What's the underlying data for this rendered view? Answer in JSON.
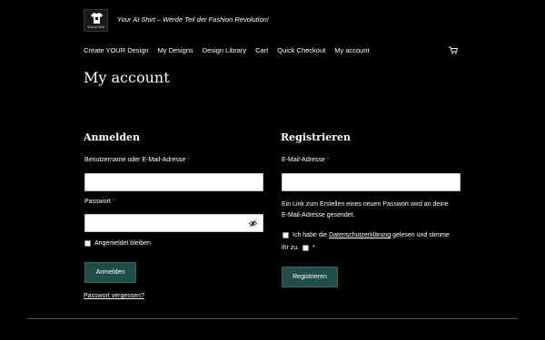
{
  "site": {
    "logo_text": "Your AI Shirt",
    "tagline": "Your AI Shirt – Werde Teil der Fashion Revolution!"
  },
  "nav": {
    "items": [
      {
        "label": "Create YOUR Design"
      },
      {
        "label": "My Designs"
      },
      {
        "label": "Design Library"
      },
      {
        "label": "Cart"
      },
      {
        "label": "Quick Checkout"
      },
      {
        "label": "My account"
      }
    ]
  },
  "page": {
    "title": "My account"
  },
  "login": {
    "heading": "Anmelden",
    "username_label": "Benutzername oder E-Mail-Adresse",
    "password_label": "Passwort",
    "required_mark": "*",
    "remember_label": "Angemeldet bleiben",
    "submit_label": "Anmelden",
    "forgot_label": "Passwort vergessen?"
  },
  "register": {
    "heading": "Registrieren",
    "email_label": "E-Mail-Adresse",
    "required_mark": "*",
    "info_line1": "Ein Link zum Erstellen eines neuen Passwort wird an deine",
    "info_line2": "E-Mail-Adresse gesendet.",
    "privacy_prefix": "Ich habe die ",
    "privacy_link": "Datenschutzerklärung",
    "privacy_suffix": " gelesen und stimme",
    "privacy_line2": "ihr zu.",
    "submit_label": "Registrieren"
  },
  "colors": {
    "background": "#000000",
    "button": "#1e4d4a",
    "required": "#e2401c"
  },
  "icons": {
    "logo": "tshirt-icon",
    "cart": "cart-icon",
    "password_toggle": "eye-slash-icon"
  }
}
